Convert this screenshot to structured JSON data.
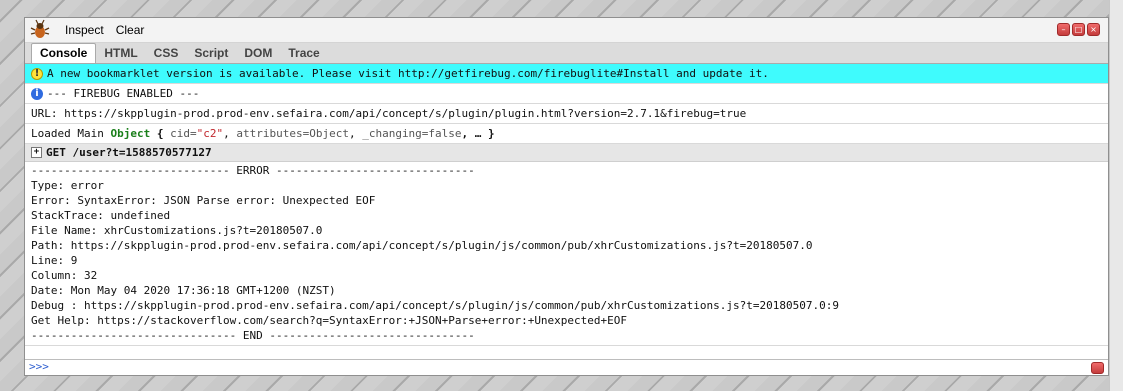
{
  "toolbar": {
    "inspect": "Inspect",
    "clear": "Clear"
  },
  "window_controls": [
    "minimize-icon",
    "restore-icon",
    "close-icon"
  ],
  "tabs": [
    {
      "label": "Console",
      "active": true
    },
    {
      "label": "HTML",
      "active": false
    },
    {
      "label": "CSS",
      "active": false
    },
    {
      "label": "Script",
      "active": false
    },
    {
      "label": "DOM",
      "active": false
    },
    {
      "label": "Trace",
      "active": false
    }
  ],
  "console": {
    "warning": "A new bookmarklet version is available. Please visit http://getfirebug.com/firebuglite#Install and update it.",
    "enabled": "--- FIREBUG ENABLED ---",
    "url_line": "URL:  https://skpplugin-prod.prod-env.sefaira.com/api/concept/s/plugin/plugin.html?version=2.7.1&firebug=true",
    "loaded": {
      "prefix": "Loaded Main ",
      "obj": "Object",
      "open": " { ",
      "k1": "cid=",
      "v1": "\"c2\"",
      "sep1": ", ",
      "k2": "attributes=Object",
      "sep2": ", ",
      "k3": "_changing=false",
      "tail": ", … }"
    },
    "group_label": "GET /user?t=1588570577127",
    "error_lines": [
      "------------------------------ ERROR ------------------------------",
      "Type: error",
      "Error: SyntaxError: JSON Parse error: Unexpected EOF",
      "StackTrace: undefined",
      "File Name: xhrCustomizations.js?t=20180507.0",
      "Path: https://skpplugin-prod.prod-env.sefaira.com/api/concept/s/plugin/js/common/pub/xhrCustomizations.js?t=20180507.0",
      "Line: 9",
      "Column: 32",
      "Date: Mon May 04 2020 17:36:18 GMT+1200 (NZST)",
      "Debug : https://skpplugin-prod.prod-env.sefaira.com/api/concept/s/plugin/js/common/pub/xhrCustomizations.js?t=20180507.0:9",
      "Get Help: https://stackoverflow.com/search?q=SyntaxError:+JSON+Parse+error:+Unexpected+EOF",
      "------------------------------- END -------------------------------"
    ]
  },
  "command_line": {
    "prompt": ">>>"
  }
}
